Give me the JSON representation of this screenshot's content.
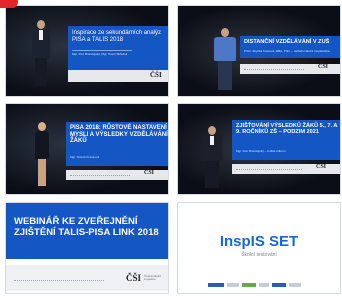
{
  "thumbnails": [
    {
      "title": "Inspirace ze sekundárních analýz PISA a TALIS 2018",
      "subtitle": "Mgr. Petr Brandejský, Mgr. Pavel Skřeček",
      "logo": "ČŠI"
    },
    {
      "title": "DISTANČNÍ VZDĚLÁVÁNÍ V ZUŠ",
      "subtitle": "PhDr. Zbyňka Koutová, MBA, PhD. – ústřední školní inspektorka",
      "logo": "ČŠI"
    },
    {
      "title": "PISA 2018: RŮSTOVÉ NASTAVENÍ MYSLI A VÝSLEDKY VZDĚLÁVÁNÍ ŽÁKŮ",
      "subtitle": "Mgr. Tereza Krausová",
      "logo": "ČŠI"
    },
    {
      "title": "ZJIŠŤOVÁNÍ VÝSLEDKŮ ŽÁKŮ 5., 7. A 9. ROČNÍKŮ ZŠ – PODZIM 2021",
      "subtitle": "Mgr. Petr Brandejský – ředitel odboru",
      "logo": "ČŠI"
    },
    {
      "title": "WEBINÁŘ KE ZVEŘEJNĚNÍ ZJIŠTĚNÍ TALIS-PISA LINK 2018",
      "logo": "ČŠI",
      "logo_sub": "Česká školní inspekce"
    },
    {
      "title": "InspIS SET",
      "subtitle": "Školní testování"
    }
  ],
  "colors": {
    "accent": "#1456c4",
    "badge": "#e3262b",
    "inspis": "#1a67d6"
  }
}
